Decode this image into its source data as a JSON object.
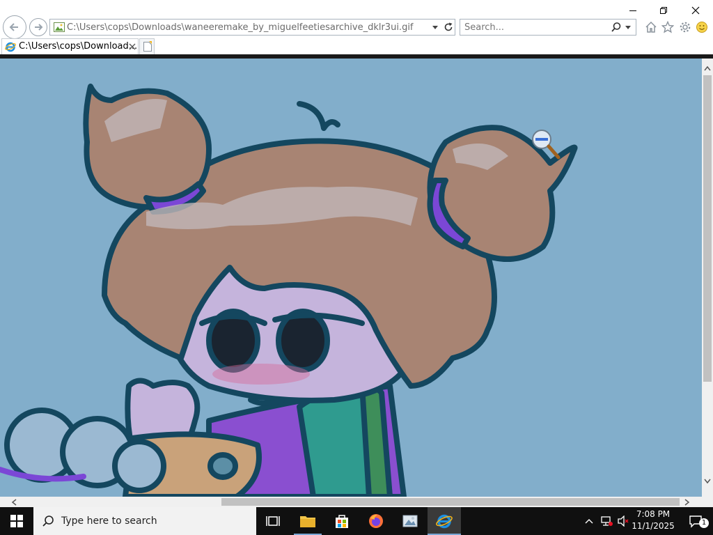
{
  "window": {
    "address": "C:\\Users\\cops\\Downloads\\waneeremake_by_miguelfeetiesarchive_dklr3ui.gif",
    "tab_title": "C:\\Users\\cops\\Download...",
    "search_placeholder": "Search..."
  },
  "icons": {
    "back": "back-arrow-icon",
    "forward": "forward-arrow-icon",
    "refresh": "refresh-icon",
    "home": "home-icon",
    "favorites": "star-icon",
    "tools": "gear-icon",
    "feedback": "smiley-icon",
    "zoom_cursor": "zoom-out-magnifier-icon"
  },
  "taskbar": {
    "search_placeholder": "Type here to search",
    "time": "7:08 PM",
    "date": "11/1/2025",
    "notification_count": "1",
    "apps": [
      "Task View",
      "File Explorer",
      "Microsoft Store",
      "Firefox",
      "Photos",
      "Internet Explorer"
    ]
  },
  "colors": {
    "image_background": "#82aecb",
    "ie_blue": "#1e8fe0",
    "taskbar": "#101010"
  }
}
